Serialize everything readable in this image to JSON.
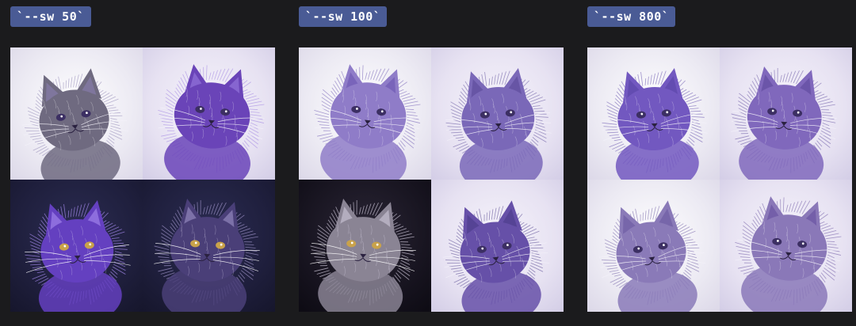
{
  "panels": [
    {
      "label": "`--sw 50`",
      "images": [
        {
          "subject": "cat",
          "bg": "light",
          "fur": "#6f6a80",
          "accent": "#8a7fb0"
        },
        {
          "subject": "cat",
          "bg": "lilac",
          "fur": "#6a44b8",
          "accent": "#9a7be0"
        },
        {
          "subject": "cat",
          "bg": "navy",
          "fur": "#6440c0",
          "accent": "#a88cf0"
        },
        {
          "subject": "cat",
          "bg": "navy",
          "fur": "#4a3f78",
          "accent": "#9f93c8"
        }
      ]
    },
    {
      "label": "`--sw 100`",
      "images": [
        {
          "subject": "cat",
          "bg": "light",
          "fur": "#8f7cc8",
          "accent": "#6b55b0"
        },
        {
          "subject": "cat",
          "bg": "lilac",
          "fur": "#7a68b8",
          "accent": "#5a4a98"
        },
        {
          "subject": "cat",
          "bg": "black",
          "fur": "#8a8494",
          "accent": "#cfc8da"
        },
        {
          "subject": "cat",
          "bg": "lilac",
          "fur": "#6650a8",
          "accent": "#4a3a88"
        }
      ]
    },
    {
      "label": "`--sw 800`",
      "images": [
        {
          "subject": "cat",
          "bg": "light",
          "fur": "#7258c0",
          "accent": "#5a44a6"
        },
        {
          "subject": "cat",
          "bg": "lilac",
          "fur": "#8068bc",
          "accent": "#5d4a9c"
        },
        {
          "subject": "cat",
          "bg": "light",
          "fur": "#8a7ab8",
          "accent": "#6a58a0"
        },
        {
          "subject": "cat",
          "bg": "lilac",
          "fur": "#8a78b8",
          "accent": "#664f9e"
        }
      ]
    }
  ],
  "colors": {
    "page_background": "#1b1b1d",
    "badge_background": "#4a5b95",
    "badge_text": "#ffffff"
  }
}
